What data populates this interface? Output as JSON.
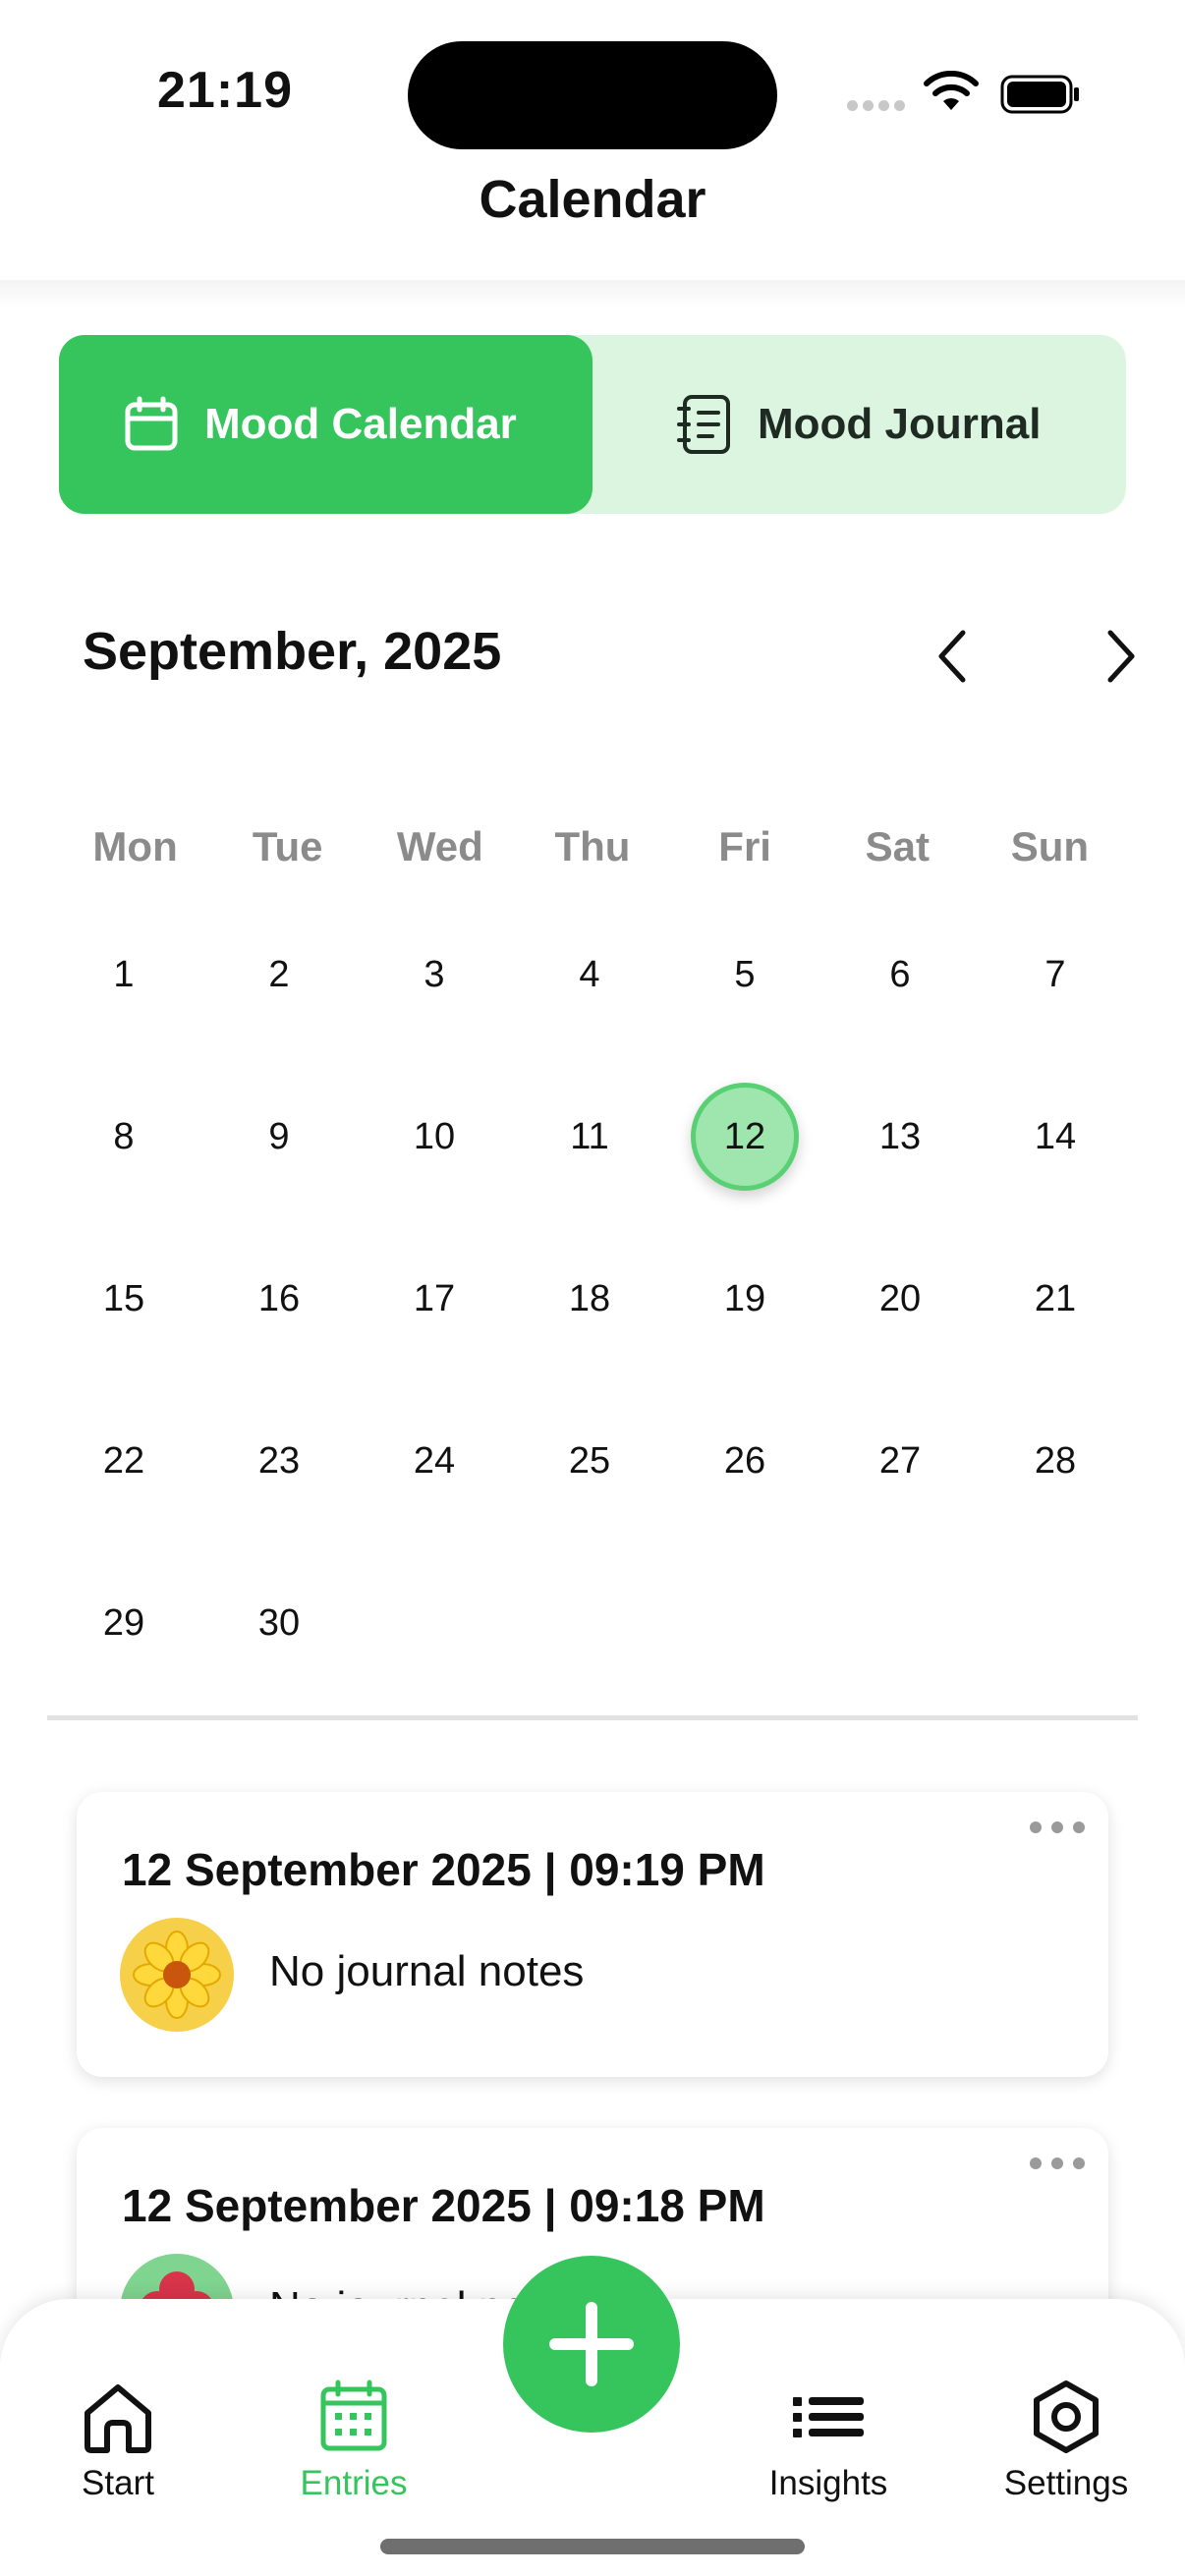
{
  "status_bar": {
    "time": "21:19"
  },
  "header": {
    "title": "Calendar"
  },
  "segment": {
    "mood_calendar_label": "Mood Calendar",
    "mood_journal_label": "Mood Journal"
  },
  "calendar": {
    "month_label": "September,  2025",
    "weekdays": [
      "Mon",
      "Tue",
      "Wed",
      "Thu",
      "Fri",
      "Sat",
      "Sun"
    ],
    "days": [
      "1",
      "2",
      "3",
      "4",
      "5",
      "6",
      "7",
      "8",
      "9",
      "10",
      "11",
      "12",
      "13",
      "14",
      "15",
      "16",
      "17",
      "18",
      "19",
      "20",
      "21",
      "22",
      "23",
      "24",
      "25",
      "26",
      "27",
      "28",
      "29",
      "30"
    ],
    "selected_day": "12"
  },
  "entries": [
    {
      "date": "12 September 2025 | 09:19 PM",
      "note": "No journal notes",
      "mood_icon": "yellow-flower-icon"
    },
    {
      "date": "12 September 2025 | 09:18 PM",
      "note": "No journal notes",
      "mood_icon": "red-flower-icon"
    }
  ],
  "tabbar": {
    "start_label": "Start",
    "entries_label": "Entries",
    "insights_label": "Insights",
    "settings_label": "Settings",
    "active_tab": "Entries"
  },
  "colors": {
    "accent": "#35c55c",
    "accent_light": "#dcf5e1",
    "selected_day": "#9ee6ae"
  }
}
